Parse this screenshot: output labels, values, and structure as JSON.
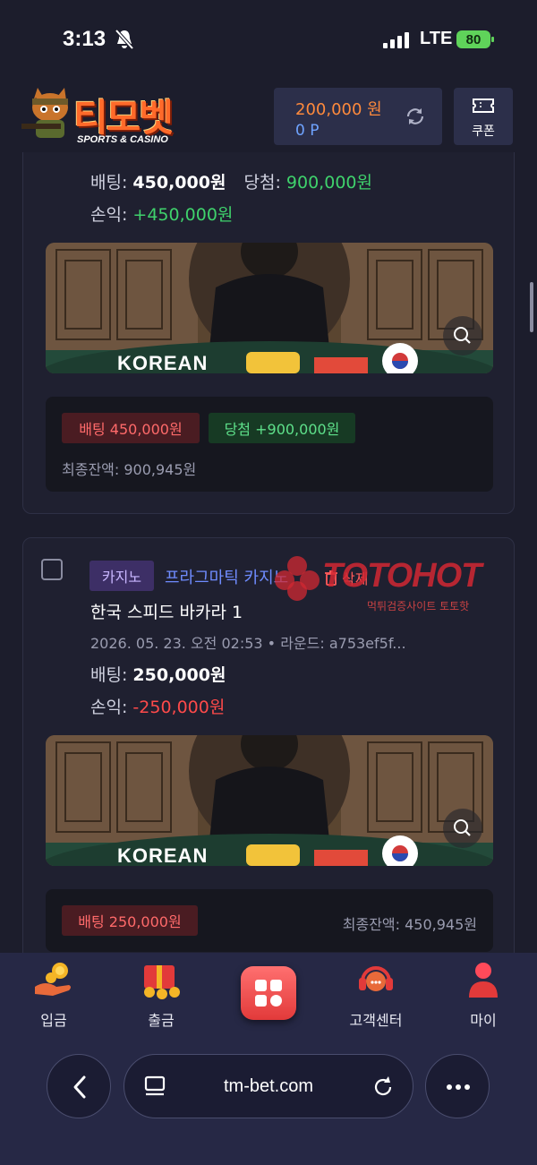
{
  "status_bar": {
    "time": "3:13",
    "network": "LTE",
    "battery": "80"
  },
  "header": {
    "logo_text": "티모벳",
    "logo_sub": "SPORTS & CASINO",
    "money": "200,000 원",
    "points": "0 P",
    "coupon_label": "쿠폰"
  },
  "card1": {
    "bet_label": "배팅:",
    "bet_value": "450,000원",
    "win_label": "당첨:",
    "win_value": "900,000원",
    "profit_label": "손익:",
    "profit_value": "+450,000원",
    "image_text": "KOREAN",
    "badge_bet": "배팅 450,000원",
    "badge_win": "당첨 +900,000원",
    "final_balance": "최종잔액: 900,945원"
  },
  "card2": {
    "category_badge": "카지노",
    "provider": "프라그마틱 카지노",
    "delete_label": "삭제",
    "game_title": "한국 스피드 바카라 1",
    "meta": "2026. 05. 23. 오전 02:53 • 라운드: a753ef5f...",
    "bet_label": "배팅:",
    "bet_value": "250,000원",
    "profit_label": "손익:",
    "profit_value": "-250,000원",
    "image_text": "KOREAN",
    "badge_bet": "배팅 250,000원",
    "final_balance": "최종잔액: 450,945원"
  },
  "watermark": {
    "title": "TOTOHOT",
    "sub": "먹튀검증사이트 토토핫"
  },
  "bottom_nav": [
    {
      "label": "입금",
      "icon": "deposit-coins-icon"
    },
    {
      "label": "출금",
      "icon": "withdraw-gift-icon"
    },
    {
      "label": "",
      "icon": "menu-grid-icon"
    },
    {
      "label": "고객센터",
      "icon": "headset-icon"
    },
    {
      "label": "마이",
      "icon": "user-icon"
    }
  ],
  "browser": {
    "url": "tm-bet.com"
  },
  "colors": {
    "accent": "#ff8a3c",
    "profit": "#3fd26c",
    "loss": "#ff4a4a",
    "point": "#6fa3ff",
    "bg": "#1c1d2c"
  }
}
